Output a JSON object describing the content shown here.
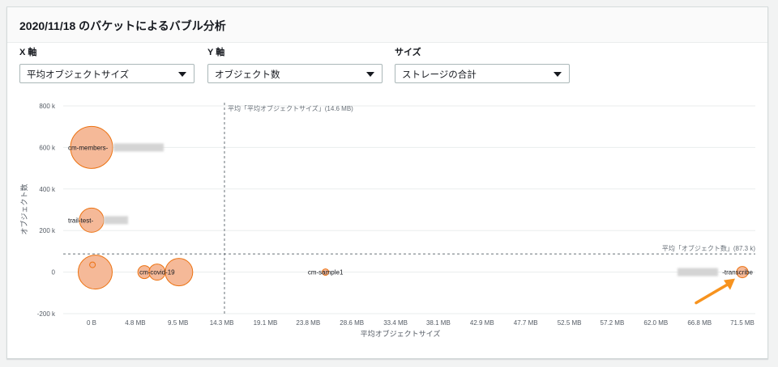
{
  "panel": {
    "title": "2020/11/18 のバケットによるバブル分析"
  },
  "controls": [
    {
      "label": "X 軸",
      "value": "平均オブジェクトサイズ",
      "icon": "chevron-down-icon"
    },
    {
      "label": "Y 軸",
      "value": "オブジェクト数",
      "icon": "chevron-down-icon"
    },
    {
      "label": "サイズ",
      "value": "ストレージの合計",
      "icon": "chevron-down-icon"
    }
  ],
  "chart_data": {
    "type": "scatter",
    "xlabel": "平均オブジェクトサイズ",
    "ylabel": "オブジェクト数",
    "xlim": [
      0,
      71.5
    ],
    "ylim": [
      -200000,
      800000
    ],
    "x_ticks": [
      0,
      4.8,
      9.5,
      14.3,
      19.1,
      23.8,
      28.6,
      33.4,
      38.1,
      42.9,
      47.7,
      52.5,
      57.2,
      62.0,
      66.8,
      71.5
    ],
    "x_tick_labels": [
      "0 B",
      "4.8 MB",
      "9.5 MB",
      "14.3 MB",
      "19.1 MB",
      "23.8 MB",
      "28.6 MB",
      "33.4 MB",
      "38.1 MB",
      "42.9 MB",
      "47.7 MB",
      "52.5 MB",
      "57.2 MB",
      "62.0 MB",
      "66.8 MB",
      "71.5 MB"
    ],
    "y_ticks": [
      -200000,
      0,
      200000,
      400000,
      600000,
      800000
    ],
    "y_tick_labels": [
      "-200 k",
      "0",
      "200 k",
      "400 k",
      "600 k",
      "800 k"
    ],
    "grid": true,
    "bubble_color": "#f4b18d",
    "bubble_stroke": "#ec7211",
    "reference_lines": [
      {
        "axis": "x",
        "value": 14.6,
        "label": "平均「平均オブジェクトサイズ」(14.6 MB)"
      },
      {
        "axis": "y",
        "value": 87300,
        "label": "平均「オブジェクト数」(87.3 k)"
      }
    ],
    "points": [
      {
        "label": "cm-members-",
        "x": 0,
        "y": 600000,
        "size": 26
      },
      {
        "label": "trail-test-",
        "x": 0,
        "y": 250000,
        "size": 15
      },
      {
        "label": "",
        "x": 0.4,
        "y": 0,
        "size": 21
      },
      {
        "label": "",
        "x": 0.1,
        "y": 35000,
        "size": 3.5
      },
      {
        "label": "",
        "x": 5.8,
        "y": 0,
        "size": 8
      },
      {
        "label": "cm-covid-19",
        "x": 7.2,
        "y": 0,
        "size": 10
      },
      {
        "label": "",
        "x": 9.6,
        "y": 0,
        "size": 17
      },
      {
        "label": "cm-sample1",
        "x": 25.7,
        "y": 0,
        "size": 4
      },
      {
        "label": "-transcribe",
        "x": 71.5,
        "y": 0,
        "size": 7
      }
    ],
    "annotations": [
      {
        "type": "arrow",
        "color": "#f7931e",
        "target": "-transcribe"
      }
    ]
  }
}
